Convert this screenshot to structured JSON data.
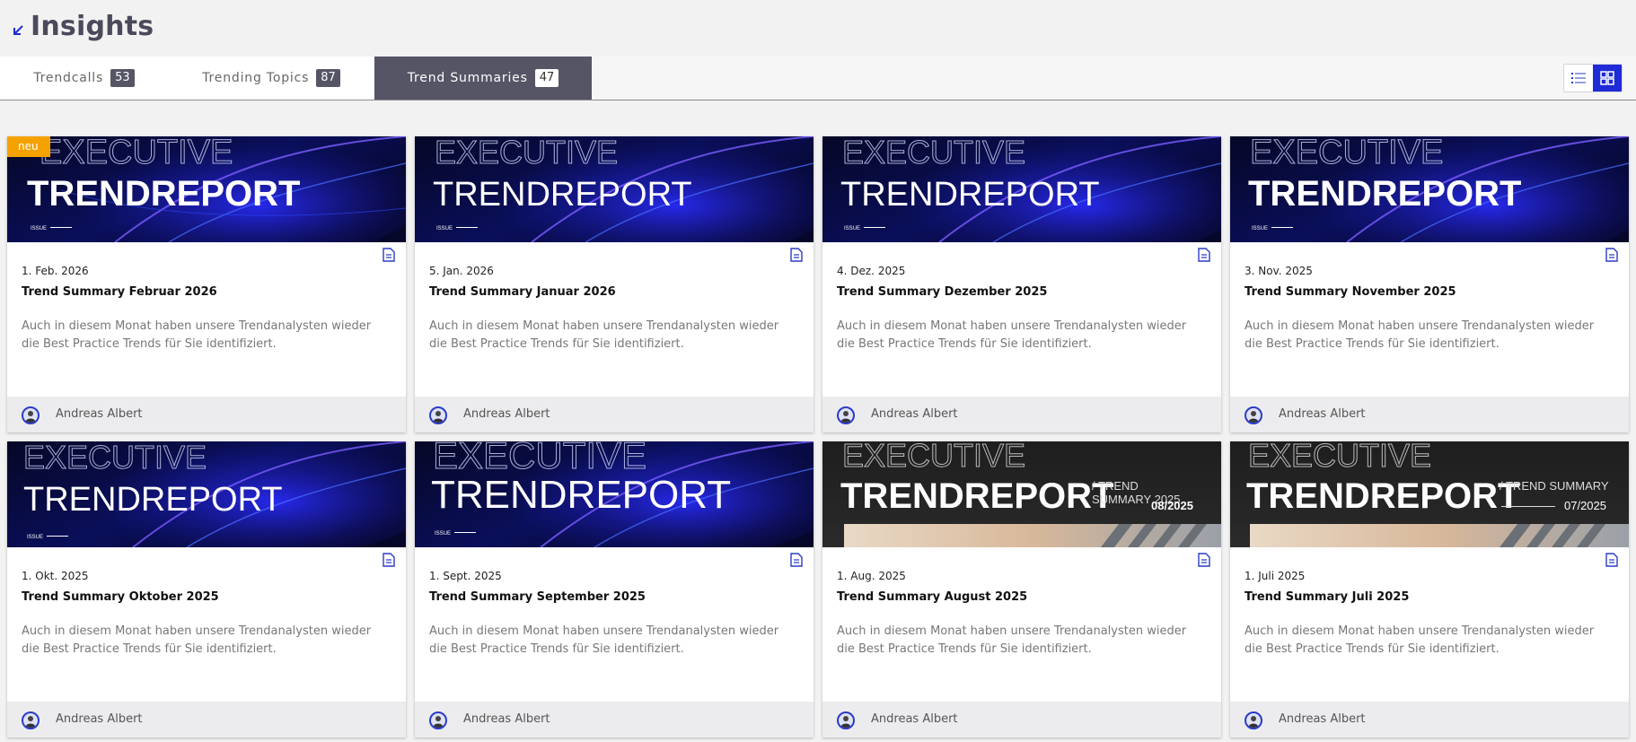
{
  "header": {
    "title": "Insights"
  },
  "tabs": [
    {
      "label": "Trendcalls",
      "count": "53"
    },
    {
      "label": "Trending Topics",
      "count": "87"
    },
    {
      "label": "Trend Summaries",
      "count": "47"
    }
  ],
  "colors": {
    "accent": "#1f2bd6",
    "tab_active": "#555566",
    "badge_new": "#f5a200"
  },
  "icons": {
    "back": "arrow-down-left-icon",
    "list_view": "list-icon",
    "grid_view": "grid-icon",
    "document": "document-icon"
  },
  "image_text": {
    "line1": "EXECUTIVE",
    "line2": "TRENDREPORT",
    "issue": "ISSUE",
    "slash_trend": "/ TREND",
    "summary_2025": "SUMMARY 2025",
    "issue_0825": "08/2025",
    "slash_trend_summary": "/ TREND SUMMARY",
    "issue_0725": "07/2025"
  },
  "cards": [
    {
      "badge": "neu",
      "date": "1. Feb. 2026",
      "title": "Trend Summary Februar 2026",
      "description": "Auch in diesem Monat haben unsere Trendanalysten wieder die Best Practice Trends für Sie identifiziert.",
      "author": "Andreas Albert"
    },
    {
      "badge": "",
      "date": "5. Jan. 2026",
      "title": "Trend Summary Januar 2026",
      "description": "Auch in diesem Monat haben unsere Trendanalysten wieder die Best Practice Trends für Sie identifiziert.",
      "author": "Andreas Albert"
    },
    {
      "badge": "",
      "date": "4. Dez. 2025",
      "title": "Trend Summary Dezember 2025",
      "description": "Auch in diesem Monat haben unsere Trendanalysten wieder die Best Practice Trends für Sie identifiziert.",
      "author": "Andreas Albert"
    },
    {
      "badge": "",
      "date": "3. Nov. 2025",
      "title": "Trend Summary November 2025",
      "description": "Auch in diesem Monat haben unsere Trendanalysten wieder die Best Practice Trends für Sie identifiziert.",
      "author": "Andreas Albert"
    },
    {
      "badge": "",
      "date": "1. Okt. 2025",
      "title": "Trend Summary Oktober 2025",
      "description": "Auch in diesem Monat haben unsere Trendanalysten wieder die Best Practice Trends für Sie identifiziert.",
      "author": "Andreas Albert"
    },
    {
      "badge": "",
      "date": "1. Sept. 2025",
      "title": "Trend Summary September 2025",
      "description": "Auch in diesem Monat haben unsere Trendanalysten wieder die Best Practice Trends für Sie identifiziert.",
      "author": "Andreas Albert"
    },
    {
      "badge": "",
      "date": "1. Aug. 2025",
      "title": "Trend Summary August 2025",
      "description": "Auch in diesem Monat haben unsere Trendanalysten wieder die Best Practice Trends für Sie identifiziert.",
      "author": "Andreas Albert"
    },
    {
      "badge": "",
      "date": "1. Juli 2025",
      "title": "Trend Summary Juli 2025",
      "description": "Auch in diesem Monat haben unsere Trendanalysten wieder die Best Practice Trends für Sie identifiziert.",
      "author": "Andreas Albert"
    }
  ]
}
